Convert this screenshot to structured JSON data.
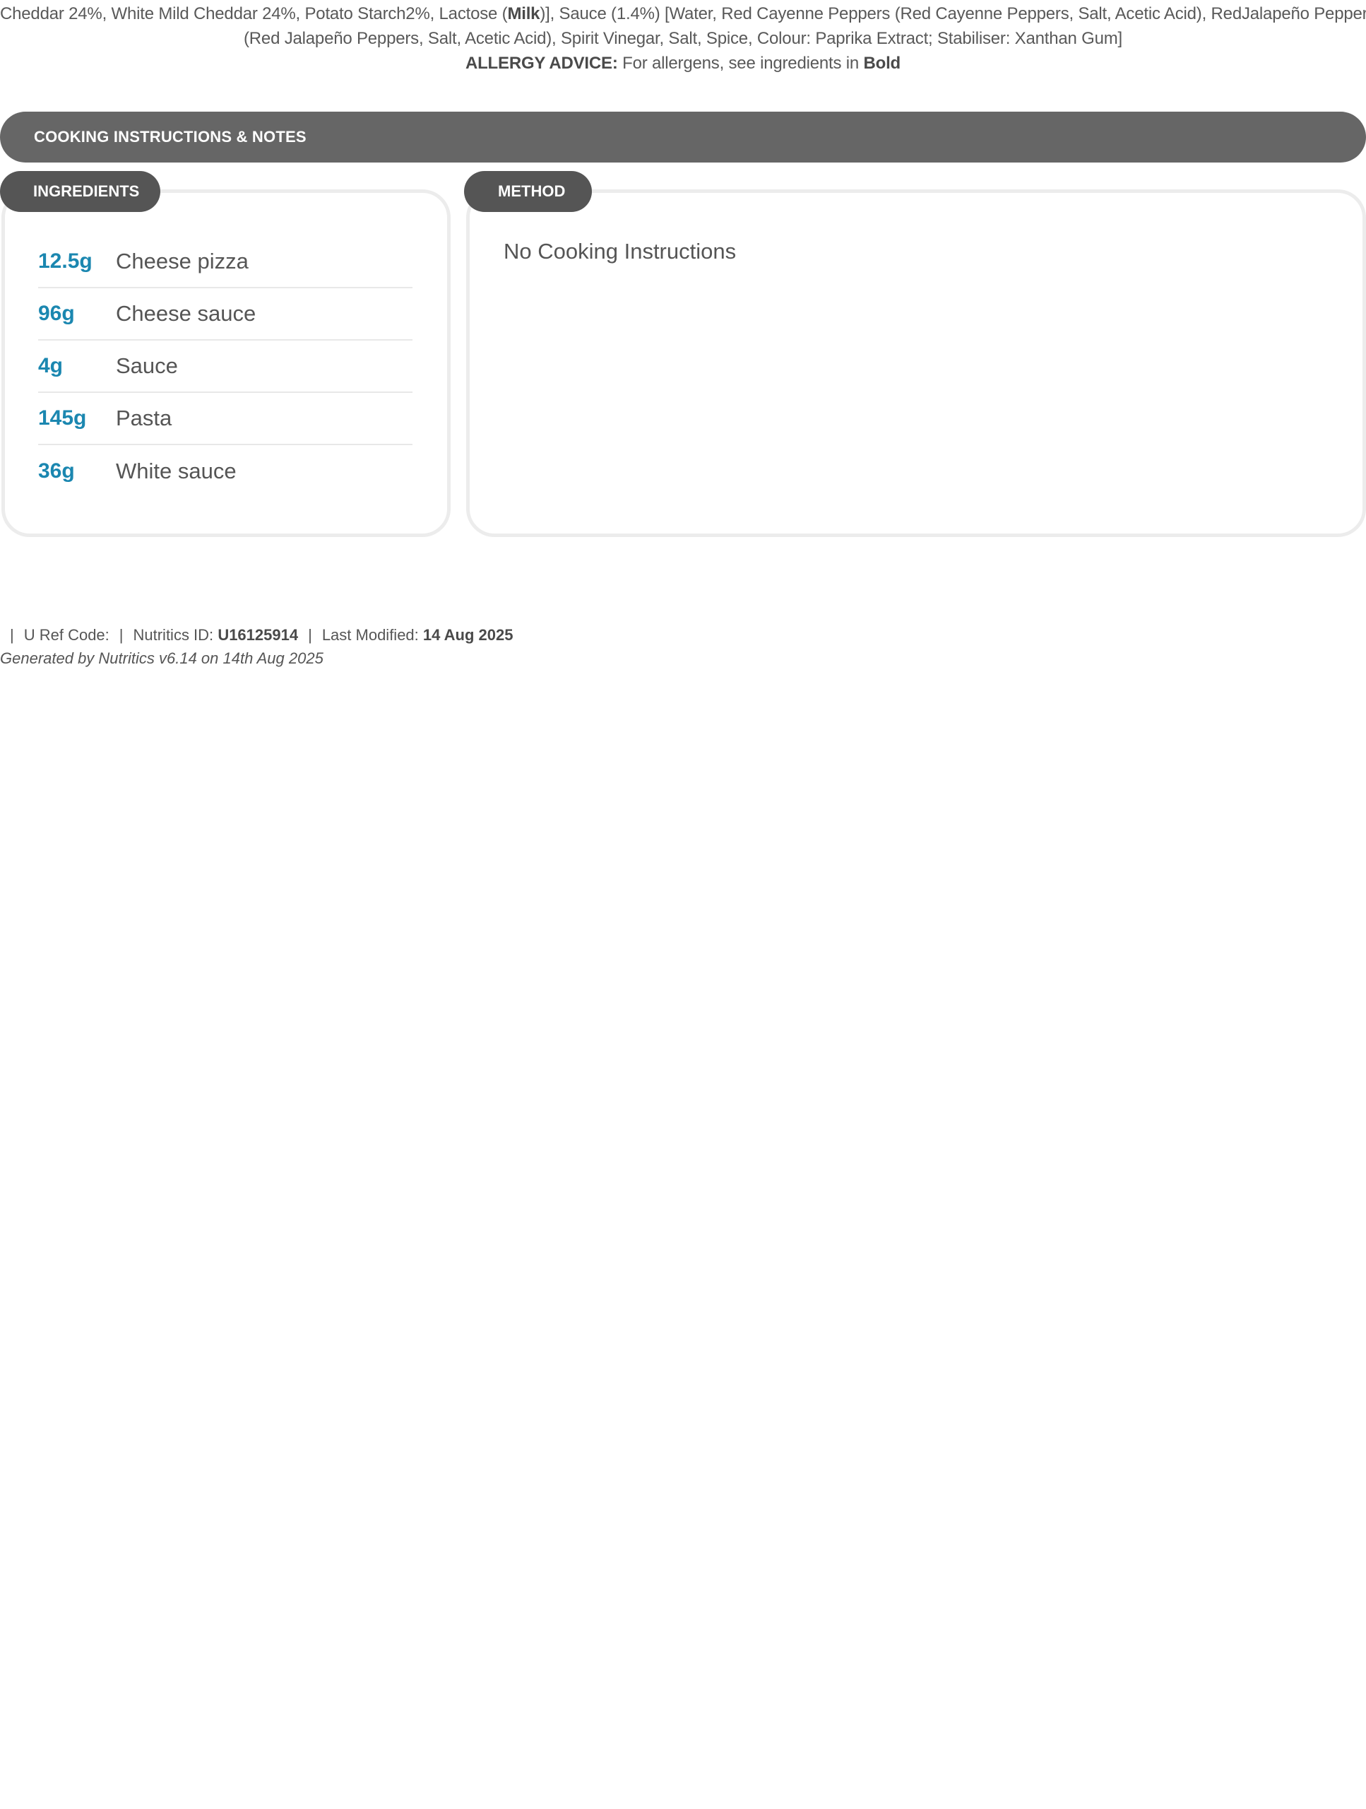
{
  "ingredients_text": {
    "line1": {
      "before": "Cheddar 24%, White Mild Cheddar 24%, Potato Starch2%, Lactose (",
      "bold": "Milk",
      "after": ")], Sauce (1.4%) [Water, Red Cayenne Peppers (Red Cayenne Peppers, Salt, Acetic Acid), RedJalapeño Peppers"
    },
    "line2": "(Red Jalapeño Peppers, Salt, Acetic Acid), Spirit Vinegar, Salt, Spice, Colour: Paprika Extract; Stabiliser: Xanthan Gum]",
    "allergy": {
      "label": "ALLERGY ADVICE:",
      "text": " For allergens, see ingredients in ",
      "bold_word": "Bold"
    }
  },
  "section": {
    "title": "COOKING INSTRUCTIONS & NOTES"
  },
  "ingredients_panel": {
    "tab_label": "INGREDIENTS",
    "items": [
      {
        "qty": "12.5g",
        "name": "Cheese pizza"
      },
      {
        "qty": "96g",
        "name": "Cheese sauce"
      },
      {
        "qty": "4g",
        "name": "Sauce"
      },
      {
        "qty": "145g",
        "name": "Pasta"
      },
      {
        "qty": "36g",
        "name": "White sauce"
      }
    ]
  },
  "method_panel": {
    "tab_label": "METHOD",
    "text": "No Cooking Instructions"
  },
  "footer": {
    "separator": "|",
    "uref_label": "U Ref Code:",
    "nutritics_label": "Nutritics ID:",
    "nutritics_id": "U16125914",
    "modified_label": "Last Modified:",
    "modified_date": "14 Aug 2025",
    "generated": "Generated by Nutritics v6.14 on 14th Aug 2025"
  },
  "colors": {
    "accent_blue": "#1b87b0",
    "bar_grey": "#666666",
    "tab_grey": "#555555",
    "panel_border": "#ececec"
  }
}
